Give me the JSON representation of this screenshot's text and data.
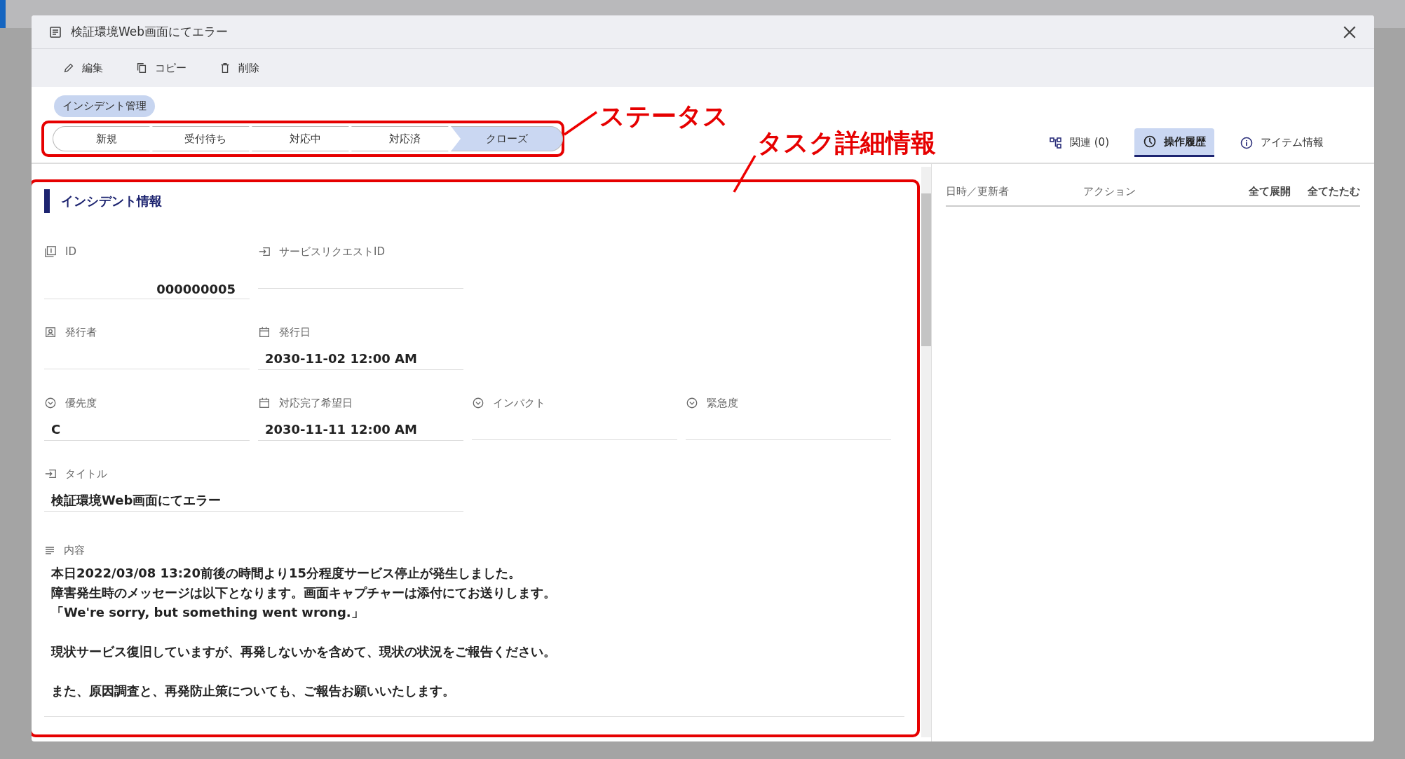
{
  "window": {
    "title": "検証環境Web画面にてエラー"
  },
  "toolbar": [
    {
      "kind": "edit",
      "label": "編集"
    },
    {
      "kind": "copy",
      "label": "コピー"
    },
    {
      "kind": "delete",
      "label": "削除"
    }
  ],
  "category_chip": "インシデント管理",
  "status_steps": [
    {
      "label": "新規",
      "selected": false
    },
    {
      "label": "受付待ち",
      "selected": false
    },
    {
      "label": "対応中",
      "selected": false
    },
    {
      "label": "対応済",
      "selected": false
    },
    {
      "label": "クローズ",
      "selected": true
    }
  ],
  "side_tabs": [
    {
      "kind": "related",
      "label": "関連 (0)",
      "selected": false
    },
    {
      "kind": "history",
      "label": "操作履歴",
      "selected": true
    },
    {
      "kind": "info",
      "label": "アイテム情報",
      "selected": false
    }
  ],
  "history_table": {
    "columns": [
      "日時／更新者",
      "アクション"
    ],
    "actions": [
      "全て展開",
      "全てたたむ"
    ]
  },
  "section_title": "インシデント情報",
  "field_rows": [
    [
      {
        "kind": "number",
        "label": "ID",
        "value": "000000005"
      },
      {
        "kind": "reference",
        "label": "サービスリクエストID"
      }
    ],
    [
      {
        "kind": "person",
        "label": "発行者"
      },
      {
        "kind": "date",
        "label": "発行日",
        "value": "2030-11-02 12:00 AM"
      }
    ],
    [
      {
        "kind": "select",
        "label": "優先度",
        "value": "C"
      },
      {
        "kind": "date",
        "label": "対応完了希望日",
        "value": "2030-11-11 12:00 AM"
      },
      {
        "kind": "select",
        "label": "インパクト"
      },
      {
        "kind": "select",
        "label": "緊急度"
      }
    ],
    [
      {
        "kind": "text",
        "label": "タイトル",
        "value": "検証環境Web画面にてエラー"
      }
    ]
  ],
  "content": {
    "label": "内容",
    "paragraphs": [
      {
        "lines": [
          "本日2022/03/08 13:20前後の時間より15分程度サービス停止が発生しました。",
          "障害発生時のメッセージは以下となります。画面キャプチャーは添付にてお送りします。",
          "「We're sorry, but something went wrong.」"
        ]
      },
      {
        "lines": [
          "現状サービス復旧していますが、再発しないかを含めて、現状の状況をご報告ください。"
        ]
      },
      {
        "lines": [
          "また、原因調査と、再発防止策についても、ご報告お願いいたします。"
        ]
      }
    ]
  },
  "annotations": {
    "status": "ステータス",
    "details": "タスク詳細情報"
  }
}
